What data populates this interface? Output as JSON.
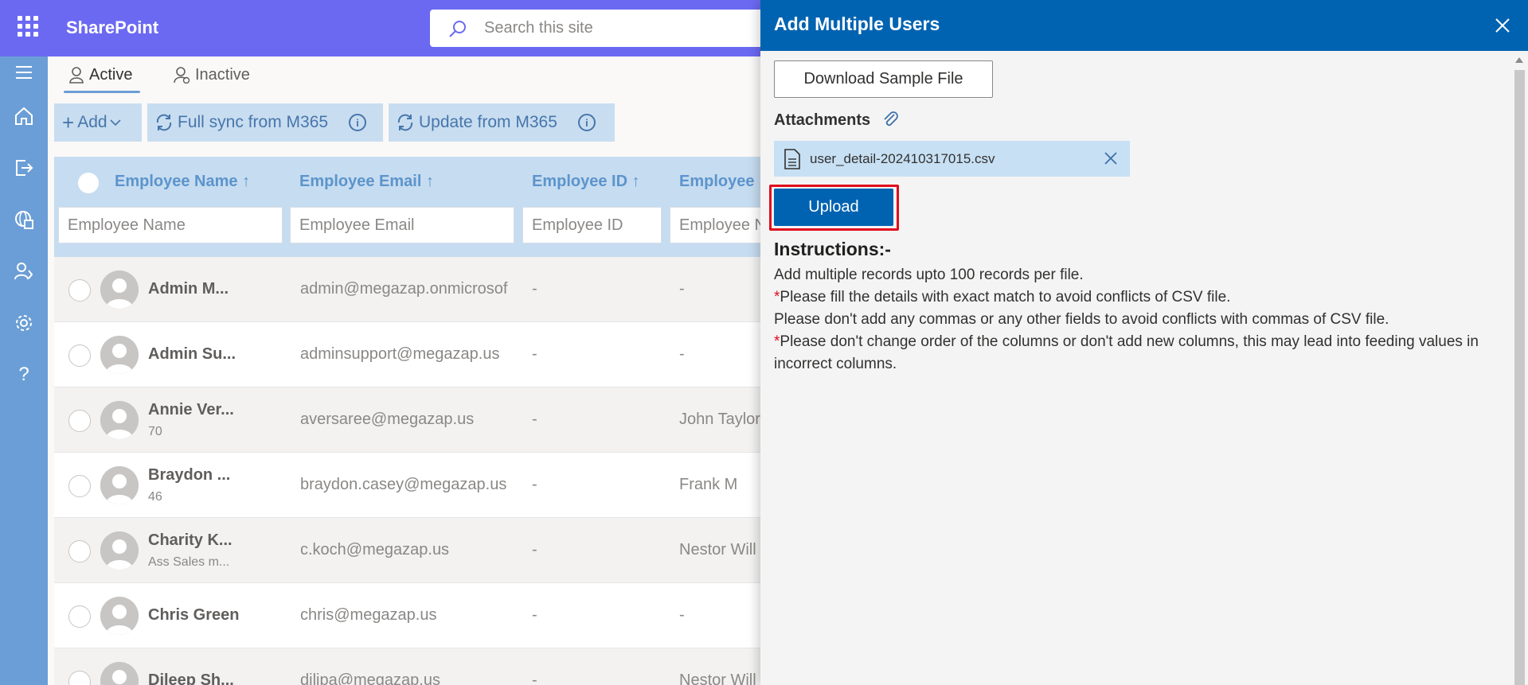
{
  "app": {
    "brand": "SharePoint",
    "search_placeholder": "Search this site"
  },
  "tabs": [
    {
      "label": "Active"
    },
    {
      "label": "Inactive"
    }
  ],
  "commands": {
    "add": "Add",
    "full_sync": "Full sync from M365",
    "update": "Update from M365",
    "info_glyph": "i"
  },
  "grid": {
    "columns": [
      {
        "label": "Employee Name ↑",
        "filter_placeholder": "Employee Name"
      },
      {
        "label": "Employee Email ↑",
        "filter_placeholder": "Employee Email"
      },
      {
        "label": "Employee ID ↑",
        "filter_placeholder": "Employee ID"
      },
      {
        "label": "Employee",
        "filter_placeholder": "Employee N"
      }
    ],
    "rows": [
      {
        "name": "Admin M...",
        "sub": "",
        "email": "admin@megazap.onmicrosof",
        "id": "-",
        "manager": "-"
      },
      {
        "name": "Admin Su...",
        "sub": "",
        "email": "adminsupport@megazap.us",
        "id": "-",
        "manager": "-"
      },
      {
        "name": "Annie Ver...",
        "sub": "70",
        "email": "aversaree@megazap.us",
        "id": "-",
        "manager": "John Taylor"
      },
      {
        "name": "Braydon ...",
        "sub": "46",
        "email": "braydon.casey@megazap.us",
        "id": "-",
        "manager": "Frank M"
      },
      {
        "name": "Charity K...",
        "sub": "Ass Sales m...",
        "email": "c.koch@megazap.us",
        "id": "-",
        "manager": "Nestor Will"
      },
      {
        "name": "Chris Green",
        "sub": "",
        "email": "chris@megazap.us",
        "id": "-",
        "manager": "-"
      },
      {
        "name": "Dileep Sh...",
        "sub": "",
        "email": "dilipa@megazap.us",
        "id": "-",
        "manager": "Nestor Will"
      }
    ]
  },
  "panel": {
    "title": "Add Multiple Users",
    "download_label": "Download Sample File",
    "attachments_label": "Attachments",
    "file_name": "user_detail-202410317015.csv",
    "upload_label": "Upload",
    "instructions_title": "Instructions:-",
    "instructions": [
      {
        "star": "",
        "text": "Add multiple records upto 100 records per file."
      },
      {
        "star": "*",
        "text": "Please fill the details with exact match to avoid conflicts of CSV file."
      },
      {
        "star": "",
        "text": "Please don't add any commas or any other fields to avoid conflicts with commas of CSV file."
      },
      {
        "star": "*",
        "text": "Please don't change order of the columns or don't add new columns, this may lead into feeding values in incorrect columns."
      }
    ]
  },
  "colors": {
    "topbar": "#6b69f2",
    "rail": "#6b9ed6",
    "panel_header": "#0063b1",
    "highlight": "#e00b1c"
  }
}
